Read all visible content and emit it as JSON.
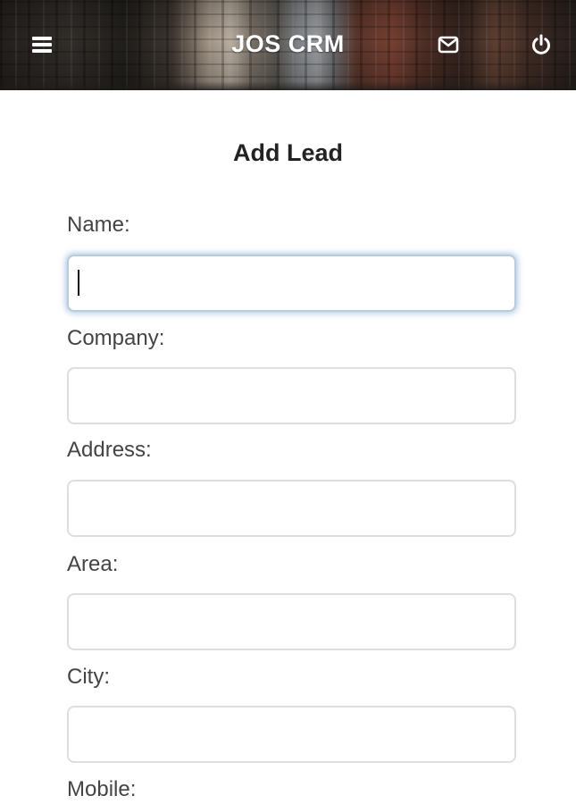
{
  "header": {
    "title": "JOS CRM",
    "menu_icon": "hamburger-menu-icon",
    "mail_icon": "envelope-icon",
    "power_icon": "power-icon",
    "text_color": "#ffffff"
  },
  "page": {
    "title": "Add Lead"
  },
  "form": {
    "fields": [
      {
        "label": "Name:",
        "value": "",
        "focused": true
      },
      {
        "label": "Company:",
        "value": ""
      },
      {
        "label": "Address:",
        "value": ""
      },
      {
        "label": "Area:",
        "value": ""
      },
      {
        "label": "City:",
        "value": ""
      },
      {
        "label": "Mobile:"
      }
    ],
    "focus_color": "#7aa0cd"
  }
}
